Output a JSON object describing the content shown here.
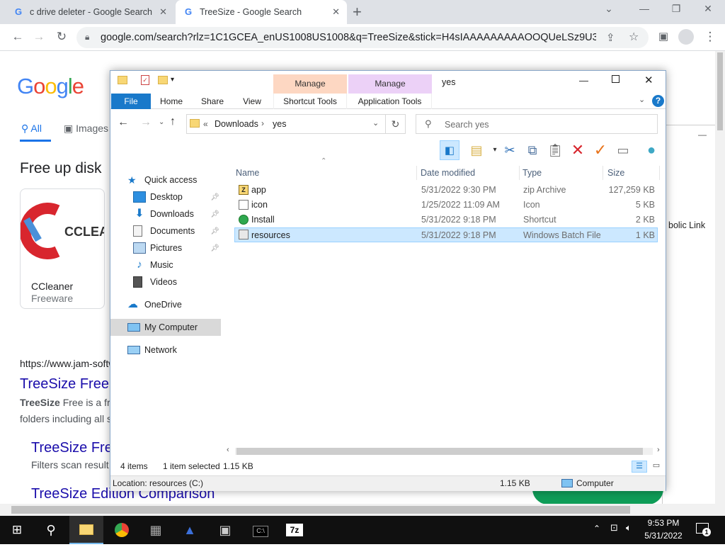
{
  "browser": {
    "tabs": [
      {
        "title": "c drive deleter - Google Search",
        "active": false
      },
      {
        "title": "TreeSize - Google Search",
        "active": true
      }
    ],
    "new_tab": "+",
    "url": "google.com/search?rlz=1C1GCEA_enUS1008US1008&q=TreeSize&stick=H4sIAAAAAAAAAOOQUeLSz9U3MDE0..."
  },
  "google": {
    "logo": "Google",
    "nav_all": "All",
    "nav_images": "Images",
    "free_heading": "Free up disk",
    "card_brand": "CCLEA",
    "card_name": "CCleaner",
    "card_sub": "Freeware",
    "result_url": "https://www.jam-softw",
    "result1_title": "TreeSize Free",
    "result1_bold": "TreeSize",
    "result1_text": " Free is a fr",
    "result1_text2": "folders including all s",
    "result2_title": "TreeSize Fre",
    "result2_text": "Filters scan result",
    "result3_title": "TreeSize Edition Comparison"
  },
  "background_window": {
    "text": "bolic Link"
  },
  "explorer": {
    "title": "yes",
    "context_groups": [
      {
        "title": "Manage",
        "subtitle": "Shortcut Tools",
        "color": "#fdd7c2"
      },
      {
        "title": "Manage",
        "subtitle": "Application Tools",
        "color": "#ecd1f7"
      }
    ],
    "ribbon_tabs": [
      "File",
      "Home",
      "Share",
      "View"
    ],
    "address": {
      "breadcrumb_prefix": "«",
      "path": [
        "Downloads",
        "yes"
      ]
    },
    "search_placeholder": "Search yes",
    "nav_pane": [
      {
        "label": "Quick access",
        "icon": "star-icon",
        "pinned": false,
        "selected": false
      },
      {
        "label": "Desktop",
        "icon": "desktop-folder-icon",
        "pinned": true,
        "selected": false
      },
      {
        "label": "Downloads",
        "icon": "downloads-folder-icon",
        "pinned": true,
        "selected": false
      },
      {
        "label": "Documents",
        "icon": "documents-folder-icon",
        "pinned": true,
        "selected": false
      },
      {
        "label": "Pictures",
        "icon": "pictures-folder-icon",
        "pinned": true,
        "selected": false
      },
      {
        "label": "Music",
        "icon": "music-folder-icon",
        "pinned": false,
        "selected": false
      },
      {
        "label": "Videos",
        "icon": "videos-folder-icon",
        "pinned": false,
        "selected": false
      },
      {
        "label": "OneDrive",
        "icon": "onedrive-icon",
        "pinned": false,
        "selected": false
      },
      {
        "label": "My Computer",
        "icon": "computer-icon",
        "pinned": false,
        "selected": true
      },
      {
        "label": "Network",
        "icon": "network-icon",
        "pinned": false,
        "selected": false
      }
    ],
    "columns": [
      "Name",
      "Date modified",
      "Type",
      "Size"
    ],
    "files": [
      {
        "name": "app",
        "date": "5/31/2022 9:30 PM",
        "type": "zip Archive",
        "size": "127,259 KB",
        "icon": "zip-icon",
        "selected": false
      },
      {
        "name": "icon",
        "date": "1/25/2022 11:09 AM",
        "type": "Icon",
        "size": "5 KB",
        "icon": "ico-file-icon",
        "selected": false
      },
      {
        "name": "Install",
        "date": "5/31/2022 9:18 PM",
        "type": "Shortcut",
        "size": "2 KB",
        "icon": "shortcut-icon",
        "selected": false
      },
      {
        "name": "resources",
        "date": "5/31/2022 9:18 PM",
        "type": "Windows Batch File",
        "size": "1 KB",
        "icon": "batch-file-icon",
        "selected": true
      }
    ],
    "status": {
      "items": "4 items",
      "selected": "1 item selected",
      "selected_size": "1.15 KB",
      "location": "Location: resources (C:)",
      "location_size": "1.15 KB",
      "computer": "Computer"
    }
  },
  "taskbar": {
    "time": "9:53 PM",
    "date": "5/31/2022",
    "notification_count": "1"
  }
}
